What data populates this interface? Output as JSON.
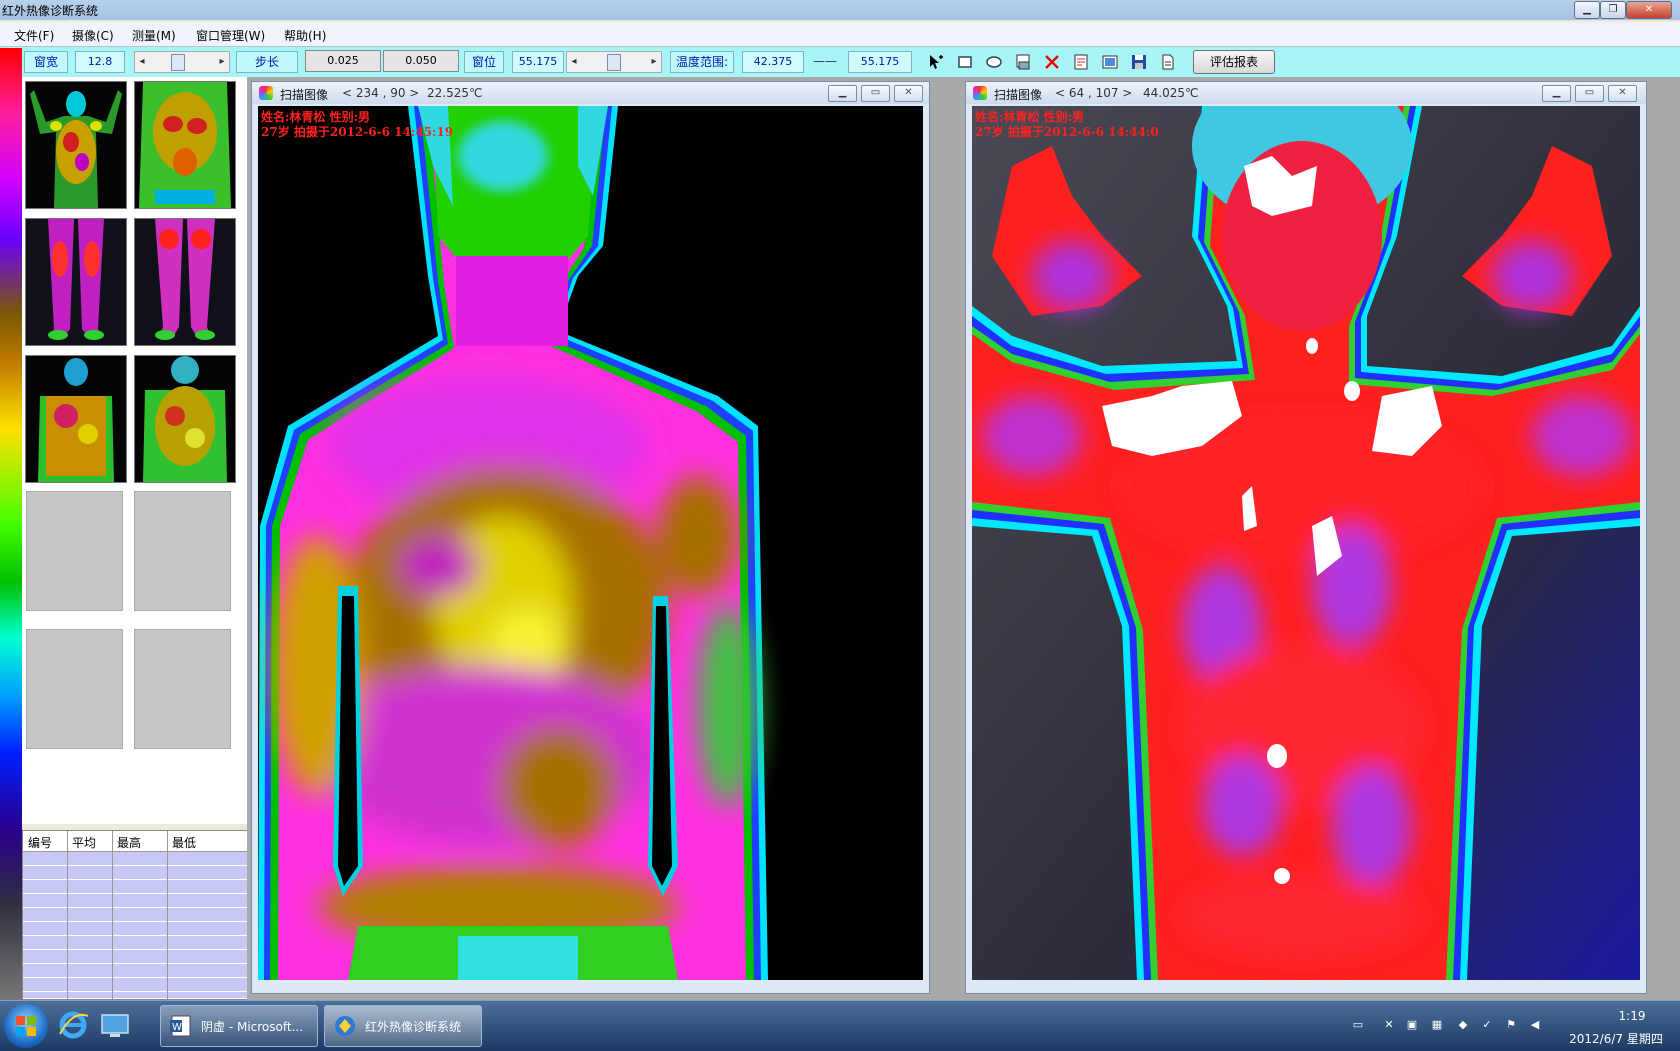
{
  "window": {
    "title": "红外热像诊断系统"
  },
  "menu": [
    {
      "label": "文件(F)"
    },
    {
      "label": "摄像(C)"
    },
    {
      "label": "测量(M)"
    },
    {
      "label": "窗口管理(W)"
    },
    {
      "label": "帮助(H)"
    }
  ],
  "toolbar": {
    "window_width_label": "窗宽",
    "window_width_value": "12.8",
    "step_label": "步长",
    "step_value_1": "0.025",
    "step_value_2": "0.050",
    "window_level_label": "窗位",
    "window_level_value": "55.175",
    "temp_range_label": "温度范围:",
    "temp_min": "42.375",
    "range_separator": "——",
    "temp_max": "55.175",
    "report_button": "评估报表",
    "icons": [
      "pointer-icon",
      "rectangle-icon",
      "ellipse-icon",
      "print-icon",
      "delete-icon",
      "export-icon",
      "image-icon",
      "save-icon",
      "document-icon"
    ]
  },
  "stats_table": {
    "columns": [
      "编号",
      "平均",
      "最高",
      "最低"
    ]
  },
  "windows": [
    {
      "title": "扫描图像",
      "coord": "< 234 , 90 >",
      "temperature": "22.525℃",
      "overlay_line1": "姓名:林青松 性别:男",
      "overlay_line2": "27岁 拍摄于2012-6-6 14:45:19"
    },
    {
      "title": "扫描图像",
      "coord": "< 64 , 107 >",
      "temperature": "44.025℃",
      "overlay_line1": "姓名:林青松 性别:男",
      "overlay_line2": "27岁 拍摄于2012-6-6 14:44:0"
    }
  ],
  "taskbar": {
    "tasks": [
      {
        "label": "阴虚 - Microsoft...",
        "icon": "word-icon"
      },
      {
        "label": "红外热像诊断系统",
        "icon": "app-icon"
      }
    ],
    "clock_time": "1:19",
    "clock_date": "2012/6/7 星期四"
  }
}
